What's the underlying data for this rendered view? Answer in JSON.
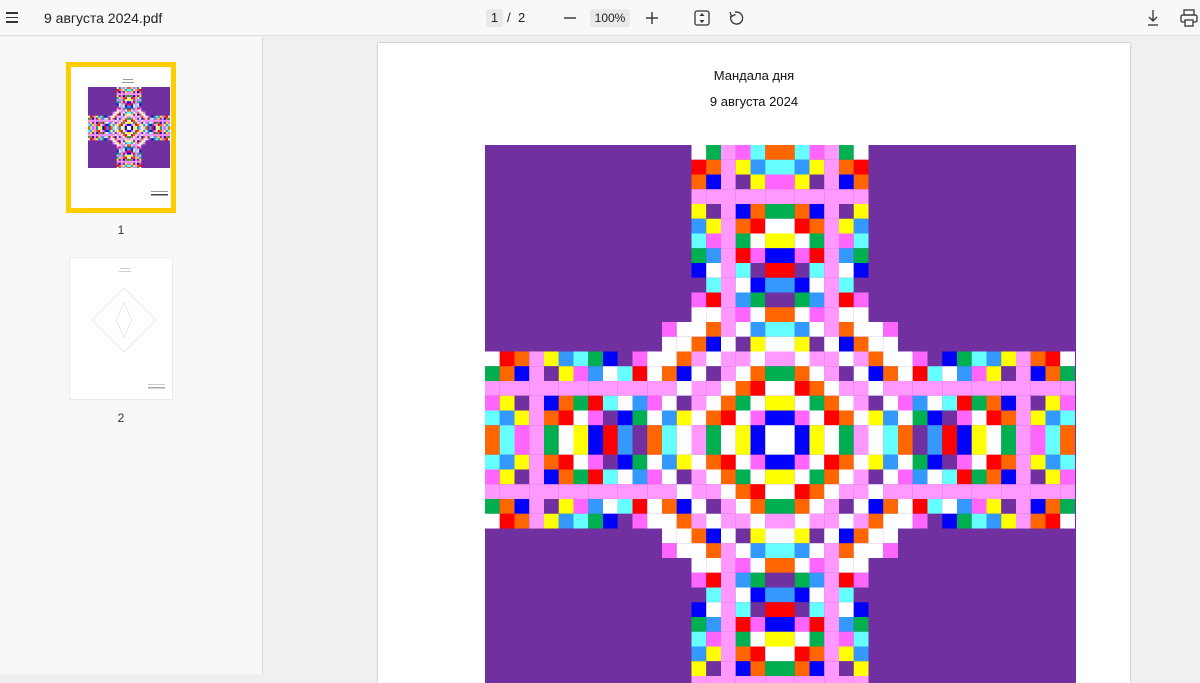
{
  "toolbar": {
    "file_name": "9 августа 2024.pdf",
    "current_page": "1",
    "page_separator": "/",
    "total_pages": "2",
    "zoom": "100%",
    "icons": [
      "menu-icon",
      "zoom-out-icon",
      "zoom-in-icon",
      "fit-page-icon",
      "rotate-icon",
      "download-icon",
      "print-icon"
    ]
  },
  "sidebar": {
    "thumbnails": [
      {
        "label": "1",
        "selected": true
      },
      {
        "label": "2",
        "selected": false
      }
    ],
    "selected_color": "#ffcc00"
  },
  "document": {
    "title": "Мандала дня",
    "date": "9 августа 2024",
    "mandala": {
      "background": "#7030a0",
      "palette": [
        "#ff0000",
        "#ff66ff",
        "#0000ff",
        "#66ffff",
        "#ffff00",
        "#ff6600",
        "#ffffff",
        "#7030a0",
        "#00b050",
        "#3399ff",
        "#ff99ff"
      ]
    }
  }
}
